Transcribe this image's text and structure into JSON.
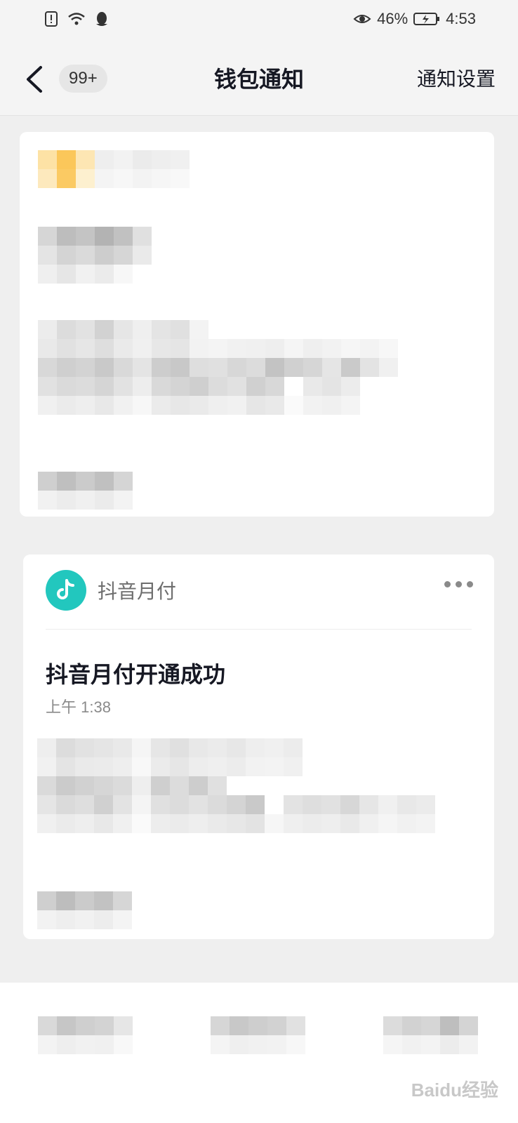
{
  "status_bar": {
    "battery_percent": "46%",
    "time": "4:53",
    "icons": [
      "alert-icon",
      "wifi-icon",
      "qq-icon",
      "eye-icon",
      "battery-icon"
    ]
  },
  "nav": {
    "back_icon": "chevron-left-icon",
    "unread_badge": "99+",
    "title": "钱包通知",
    "settings_label": "通知设置"
  },
  "cards": [
    {
      "blurred": true
    },
    {
      "app_name": "抖音月付",
      "app_icon": "douyin-logo-icon",
      "more_icon": "more-horizontal-icon",
      "title": "抖音月付开通成功",
      "time": "上午 1:38",
      "body_blurred": true
    }
  ],
  "watermark": "Baidu经验",
  "colors": {
    "accent_teal": "#22c7be",
    "background": "#efefef",
    "card": "#ffffff",
    "text_primary": "#161823",
    "text_secondary": "#8a8a8a"
  }
}
